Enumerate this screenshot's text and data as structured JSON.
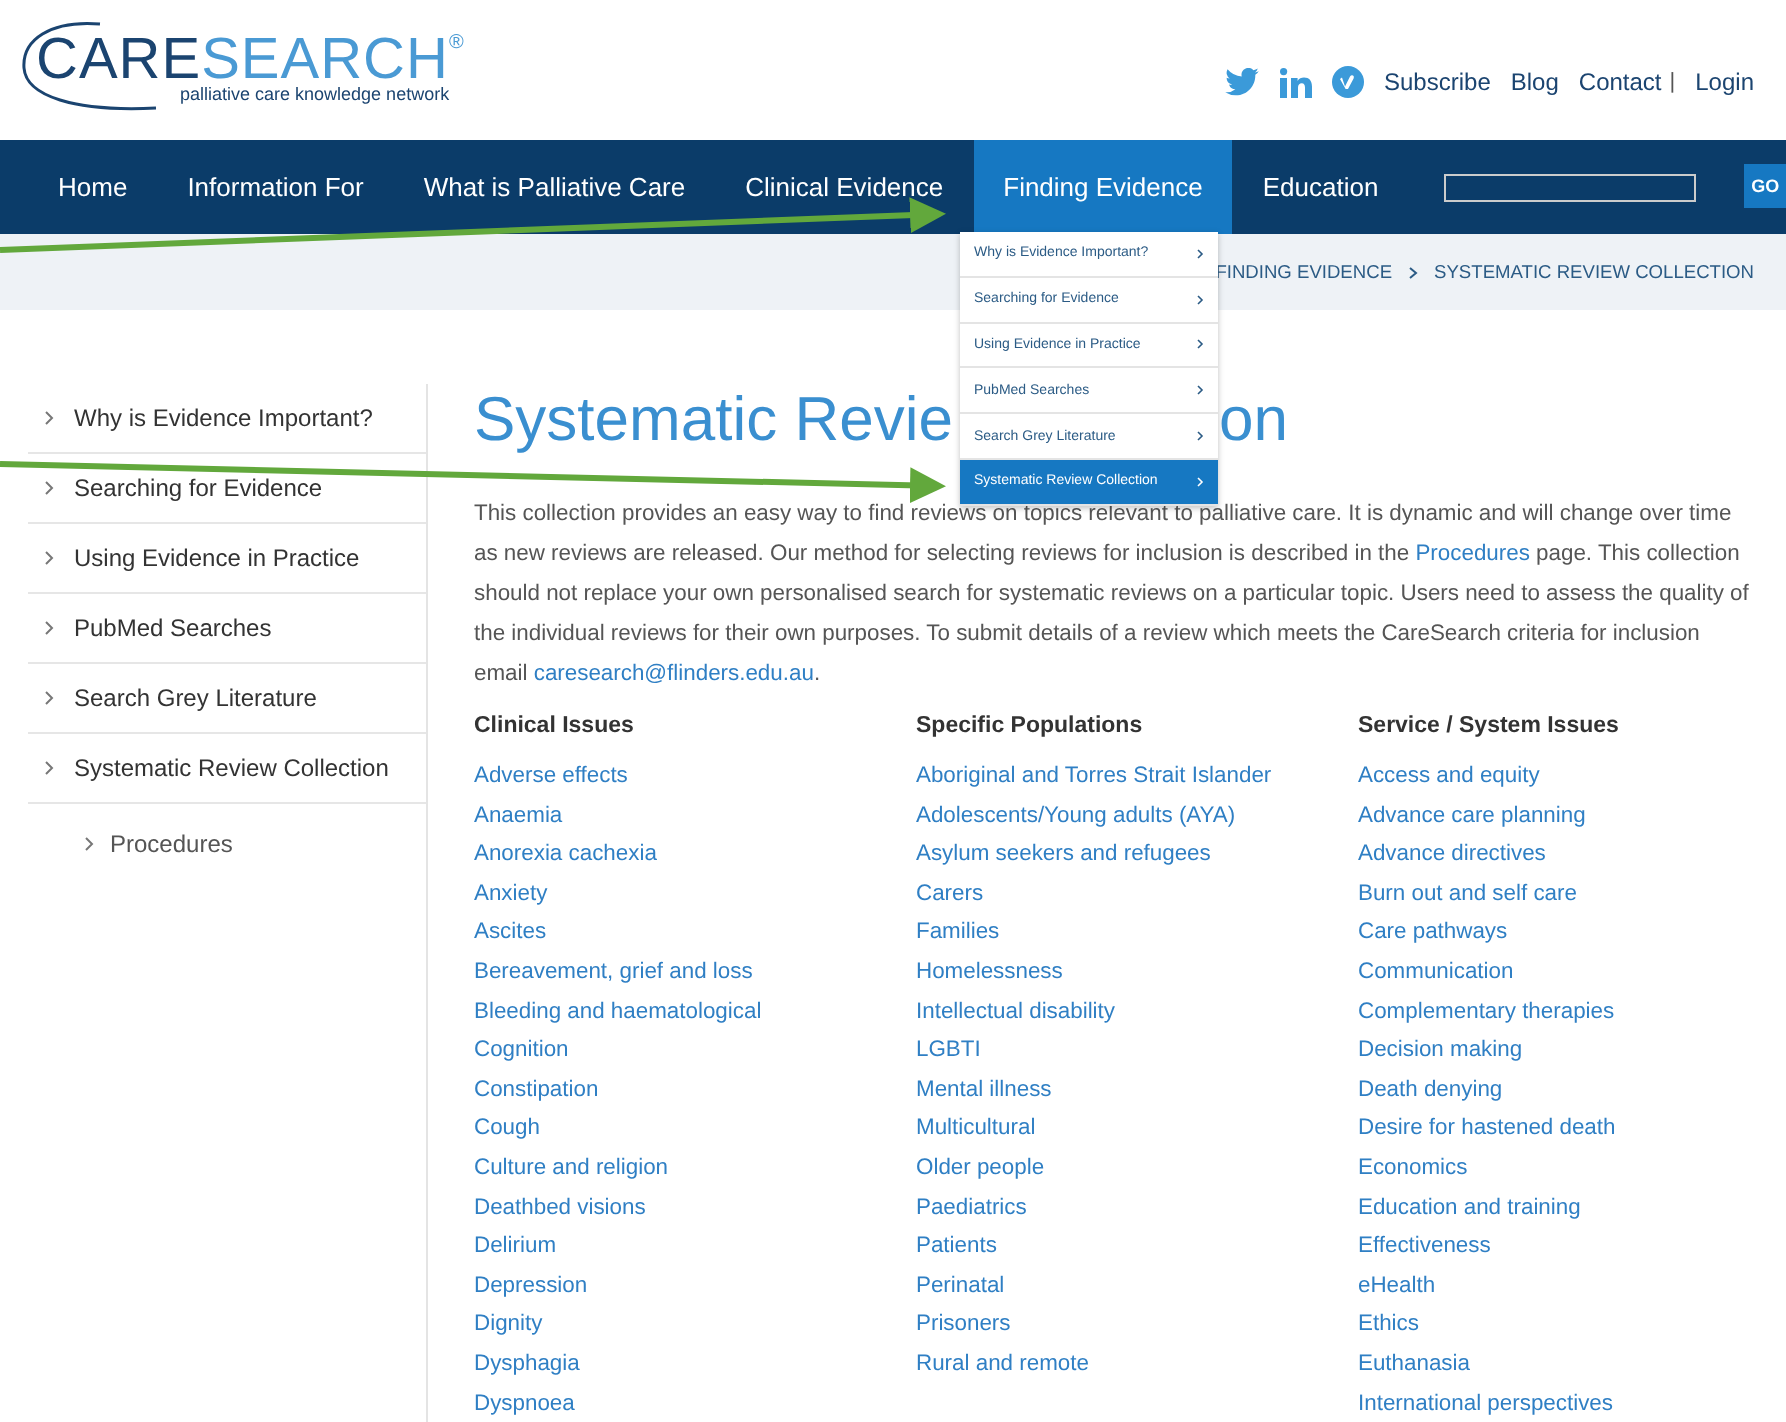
{
  "logo": {
    "word_1": "CARE",
    "word_2": "SEARCH",
    "mark": "®",
    "tagline": "palliative care knowledge network"
  },
  "top_links": [
    {
      "label": "Subscribe"
    },
    {
      "label": "Blog"
    },
    {
      "label": "Contact"
    },
    {
      "label": "|",
      "kind": "separator"
    },
    {
      "label": "Login"
    }
  ],
  "nav": {
    "items": [
      {
        "label": "Home",
        "selected": false
      },
      {
        "label": "Information For",
        "selected": false
      },
      {
        "label": "What is Palliative Care",
        "selected": false
      },
      {
        "label": "Clinical Evidence",
        "selected": false
      },
      {
        "label": "Finding Evidence",
        "selected": true
      },
      {
        "label": "Education",
        "selected": false
      }
    ],
    "search_button": "GO"
  },
  "dropdown": [
    {
      "label": "Why is Evidence Important?",
      "selected": false
    },
    {
      "label": "Searching for Evidence",
      "selected": false
    },
    {
      "label": "Using Evidence in Practice",
      "selected": false
    },
    {
      "label": "PubMed Searches",
      "selected": false
    },
    {
      "label": "Search Grey Literature",
      "selected": false
    },
    {
      "label": "Systematic Review Collection",
      "selected": true
    }
  ],
  "breadcrumb": [
    "FINDING EVIDENCE",
    "SYSTEMATIC REVIEW COLLECTION"
  ],
  "sidebar": {
    "items": [
      {
        "label": "Why is Evidence Important?"
      },
      {
        "label": "Searching for Evidence"
      },
      {
        "label": "Using Evidence in Practice"
      },
      {
        "label": "PubMed Searches"
      },
      {
        "label": "Search Grey Literature"
      },
      {
        "label": "Systematic Review Collection",
        "children": [
          {
            "label": "Procedures"
          }
        ]
      }
    ]
  },
  "title": [
    "Systematic Revie",
    "on"
  ],
  "intro": {
    "before": "This collection provides an easy way to find reviews on topics relevant to palliative care. It is dynamic and will change over time as new reviews are released. Our method for selecting reviews for inclusion is described in the ",
    "link": "Procedures",
    "middle": " page. This collection should not replace your own personalised search for systematic reviews on a particular topic. Users need to assess the quality of the individual reviews for their own purposes. To submit details of a review which meets the CareSearch criteria for inclusion email ",
    "email": "caresearch@flinders.edu.au",
    "after": "."
  },
  "columns": [
    {
      "heading": "Clinical Issues",
      "links": [
        "Adverse effects",
        "Anaemia",
        "Anorexia cachexia",
        "Anxiety",
        "Ascites",
        "Bereavement, grief and loss",
        "Bleeding and haematological",
        "Cognition",
        "Constipation",
        "Cough",
        "Culture and religion",
        "Deathbed visions",
        "Delirium",
        "Depression",
        "Dignity",
        "Dysphagia",
        "Dyspnoea"
      ]
    },
    {
      "heading": "Specific Populations",
      "links": [
        "Aboriginal and Torres Strait Islander",
        "Adolescents/Young adults (AYA)",
        "Asylum seekers and refugees",
        "Carers",
        "Families",
        "Homelessness",
        "Intellectual disability",
        "LGBTI",
        "Mental illness",
        "Multicultural",
        "Older people",
        "Paediatrics",
        "Patients",
        "Perinatal",
        "Prisoners",
        "Rural and remote"
      ]
    },
    {
      "heading": "Service / System Issues",
      "links": [
        "Access and equity",
        "Advance care planning",
        "Advance directives",
        "Burn out and self care",
        "Care pathways",
        "Communication",
        "Complementary therapies",
        "Decision making",
        "Death denying",
        "Desire for hastened death",
        "Economics",
        "Education and training",
        "Effectiveness",
        "eHealth",
        "Ethics",
        "Euthanasia",
        "International perspectives"
      ]
    }
  ]
}
